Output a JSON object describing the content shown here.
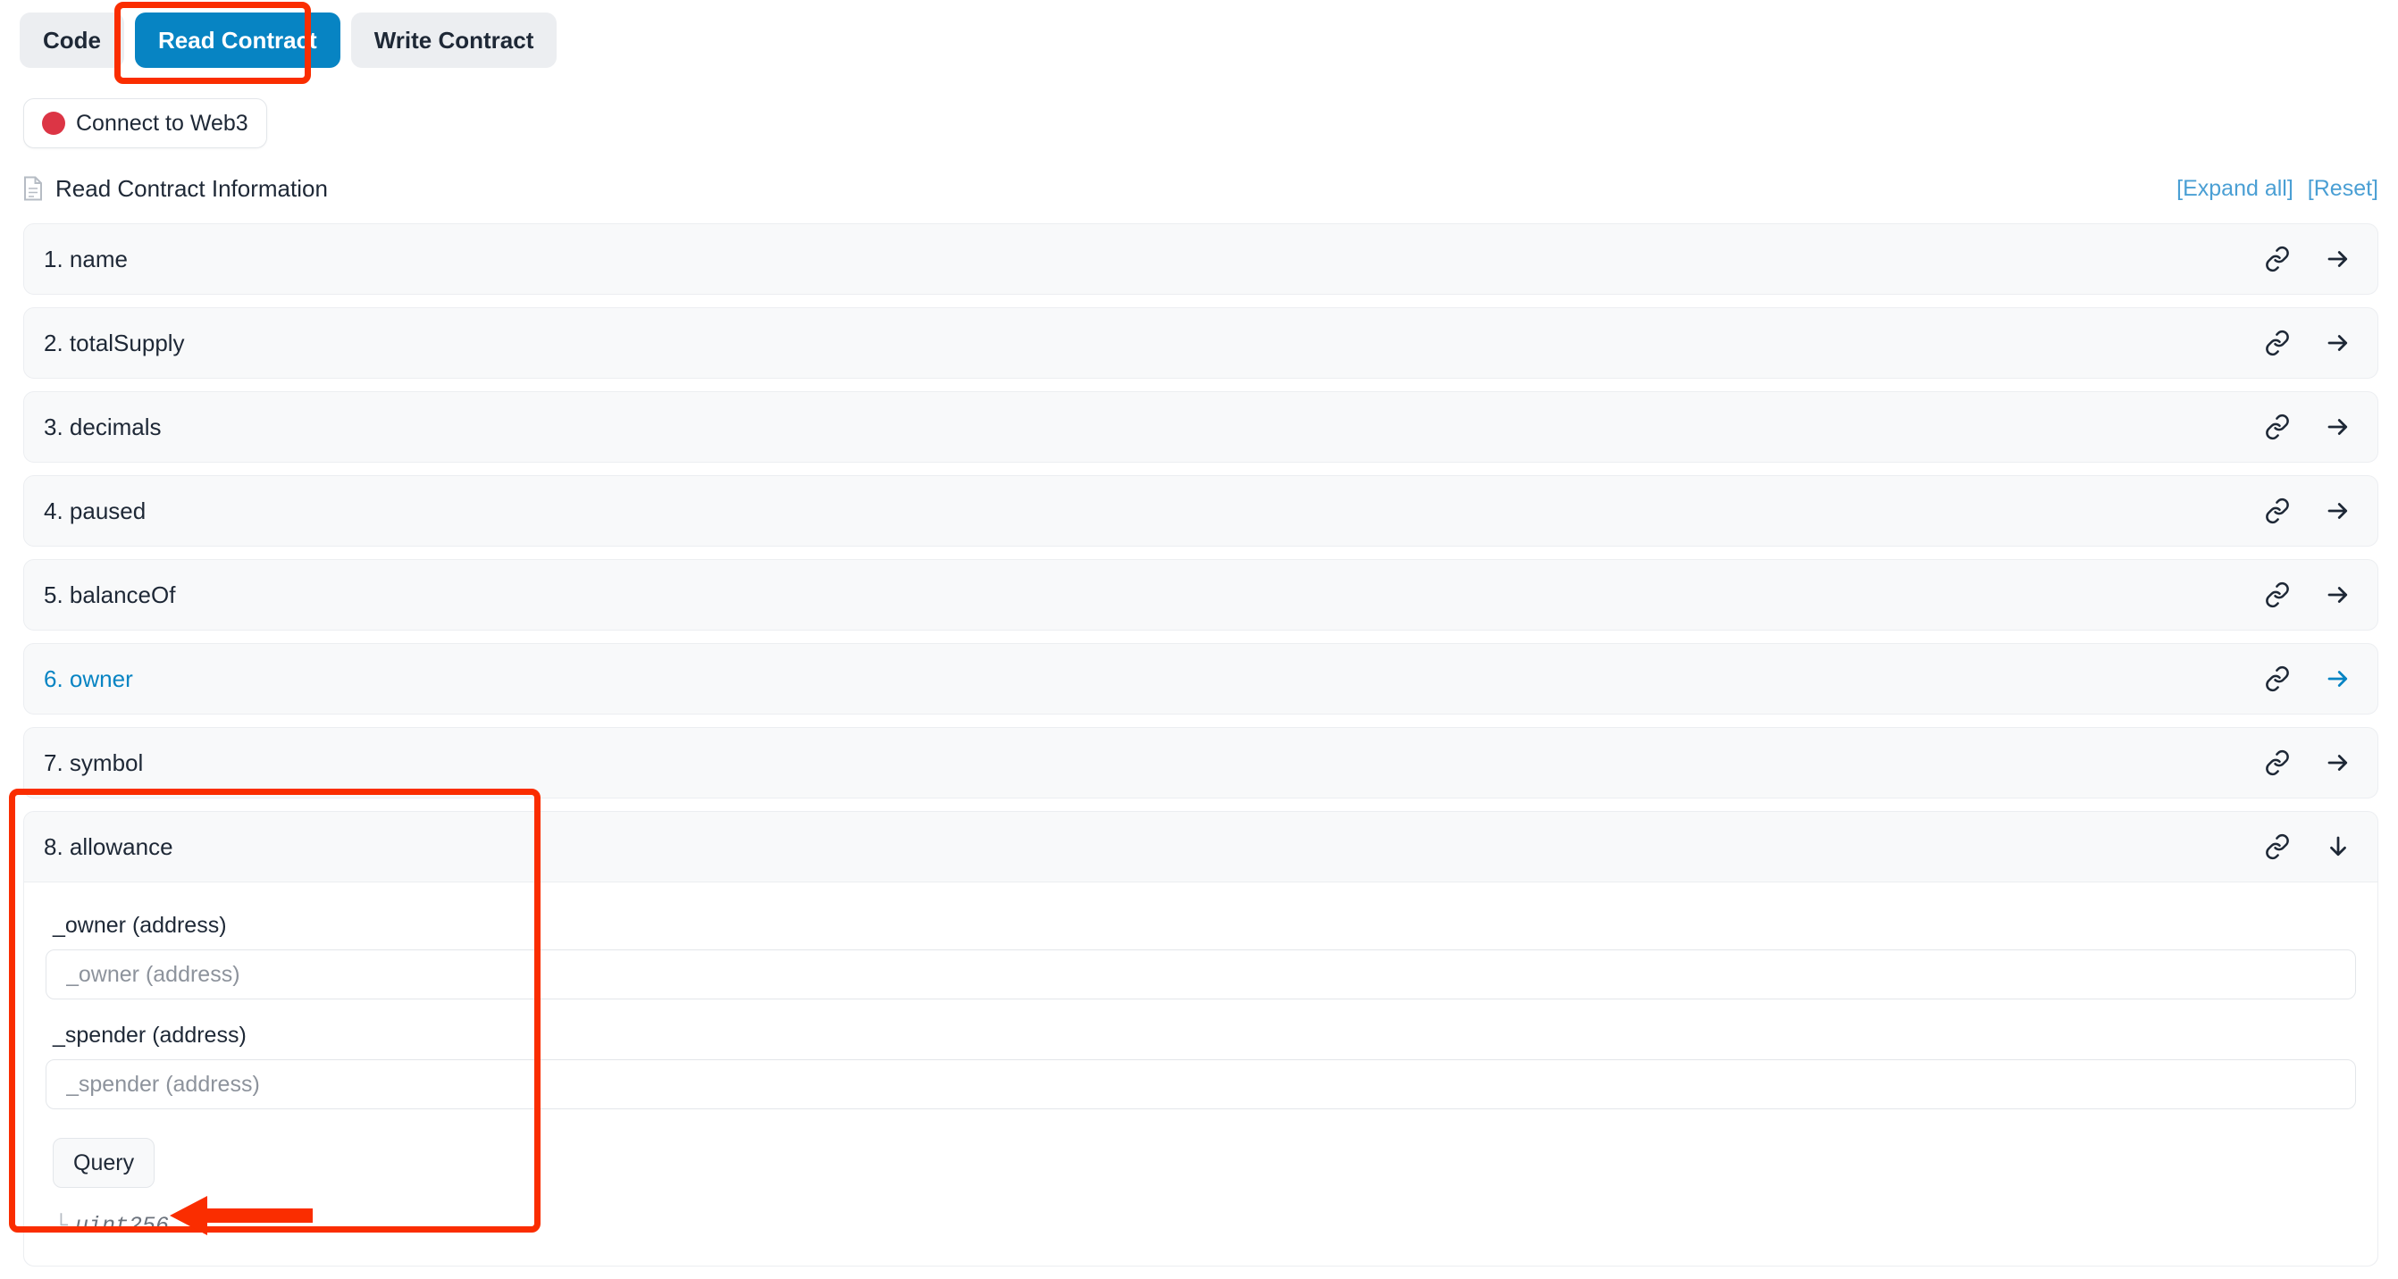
{
  "tabs": [
    {
      "label": "Code",
      "active": false
    },
    {
      "label": "Read Contract",
      "active": true
    },
    {
      "label": "Write Contract",
      "active": false
    }
  ],
  "connect": {
    "label": "Connect to Web3",
    "status_color": "#dc3545"
  },
  "section": {
    "title": "Read Contract Information",
    "expand_all": "[Expand all]",
    "reset": "[Reset]",
    "link_color": "#4a9fd4"
  },
  "functions": [
    {
      "label": "1. name",
      "linked": false,
      "expanded": false
    },
    {
      "label": "2. totalSupply",
      "linked": false,
      "expanded": false
    },
    {
      "label": "3. decimals",
      "linked": false,
      "expanded": false
    },
    {
      "label": "4. paused",
      "linked": false,
      "expanded": false
    },
    {
      "label": "5. balanceOf",
      "linked": false,
      "expanded": false
    },
    {
      "label": "6. owner",
      "linked": true,
      "expanded": false
    },
    {
      "label": "7. symbol",
      "linked": false,
      "expanded": false
    },
    {
      "label": "8. allowance",
      "linked": false,
      "expanded": true
    }
  ],
  "allowance": {
    "title": "8. allowance",
    "owner_label": "_owner (address)",
    "owner_placeholder": "_owner (address)",
    "owner_value": "",
    "spender_label": "_spender (address)",
    "spender_placeholder": "_spender (address)",
    "spender_value": "",
    "query_label": "Query",
    "return_corner": "└",
    "return_type": "uint256"
  },
  "theme": {
    "accent_blue": "#0784c3",
    "annotation_red": "#fa2d00",
    "row_bg": "#f8f9fa",
    "text": "#1e2836"
  }
}
